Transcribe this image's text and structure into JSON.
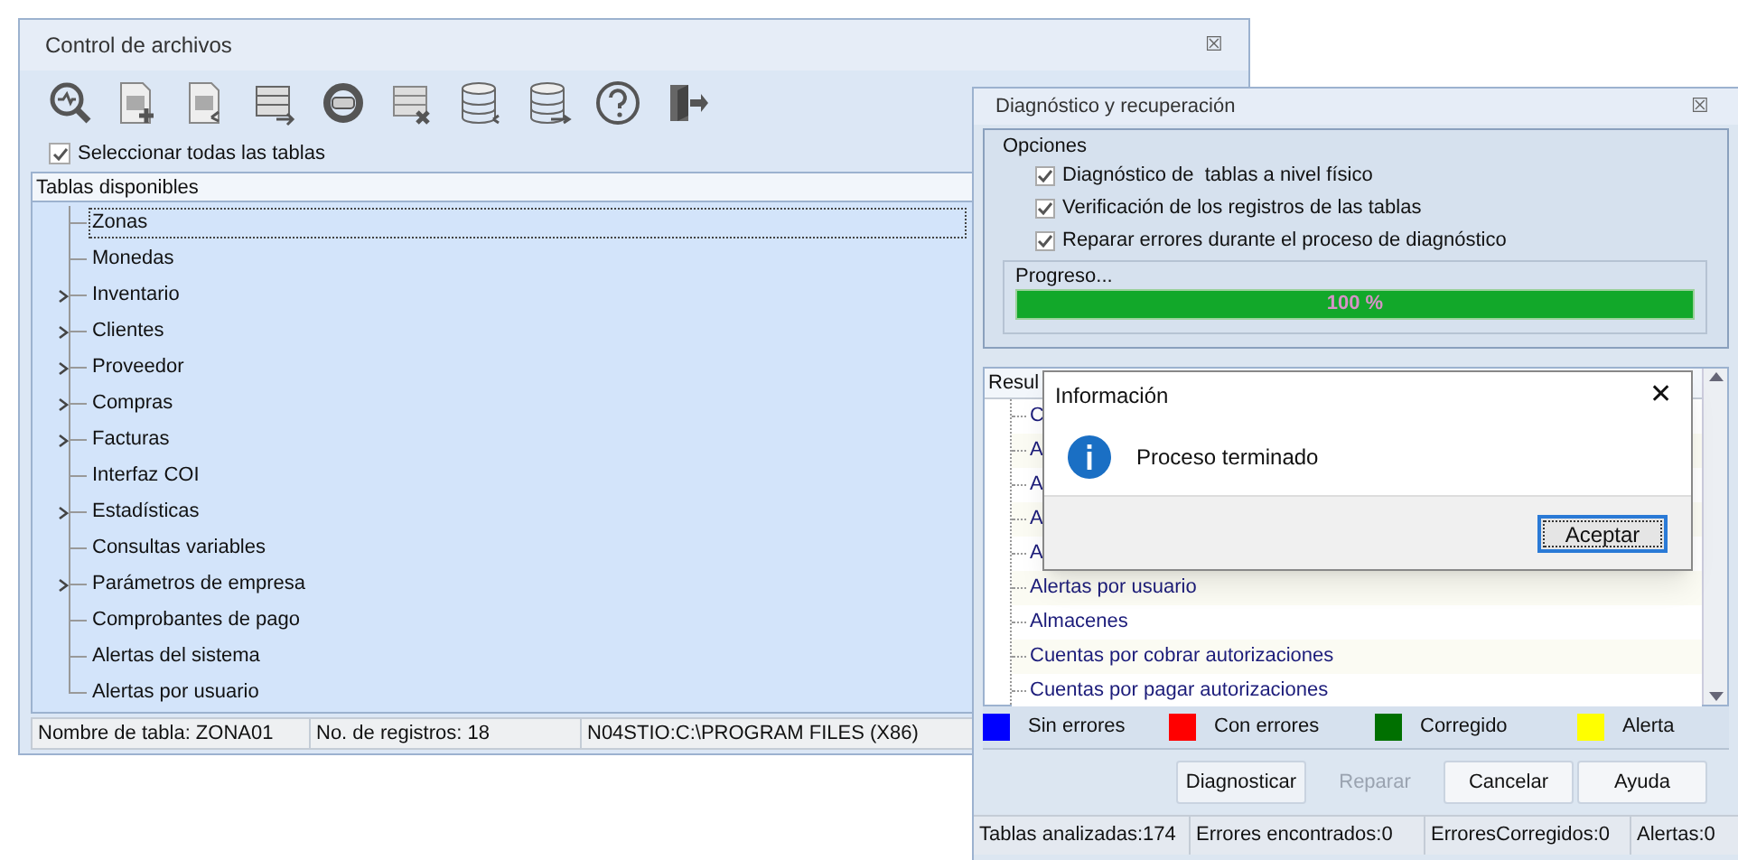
{
  "main_window": {
    "title": "Control de archivos",
    "close": "☒",
    "select_all": {
      "label": "Seleccionar todas las tablas",
      "checked": true
    },
    "tree": {
      "header": "Tablas disponibles",
      "items": [
        {
          "label": "Zonas",
          "expandable": false,
          "selected": true
        },
        {
          "label": "Monedas",
          "expandable": false,
          "selected": false
        },
        {
          "label": "Inventario",
          "expandable": true,
          "selected": false
        },
        {
          "label": "Clientes",
          "expandable": true,
          "selected": false
        },
        {
          "label": "Proveedor",
          "expandable": true,
          "selected": false
        },
        {
          "label": "Compras",
          "expandable": true,
          "selected": false
        },
        {
          "label": "Facturas",
          "expandable": true,
          "selected": false
        },
        {
          "label": "Interfaz COI",
          "expandable": false,
          "selected": false
        },
        {
          "label": "Estadísticas",
          "expandable": true,
          "selected": false
        },
        {
          "label": "Consultas variables",
          "expandable": false,
          "selected": false
        },
        {
          "label": "Parámetros de empresa",
          "expandable": true,
          "selected": false
        },
        {
          "label": "Comprobantes de pago",
          "expandable": false,
          "selected": false
        },
        {
          "label": "Alertas del sistema",
          "expandable": false,
          "selected": false
        },
        {
          "label": "Alertas por usuario",
          "expandable": false,
          "selected": false
        }
      ]
    },
    "status_bar": [
      "Nombre de tabla: ZONA01",
      "No. de registros: 18",
      "N04STIO:C:\\PROGRAM FILES (X86)"
    ]
  },
  "diagnostic_window": {
    "title": "Diagnóstico y recuperación",
    "close": "☒",
    "options": {
      "title": "Opciones",
      "items": [
        {
          "label": "Diagnóstico de  tablas a nivel físico",
          "checked": true
        },
        {
          "label": "Verificación de los registros de las tablas",
          "checked": true
        },
        {
          "label": "Reparar errores durante el proceso de diagnóstico",
          "checked": true
        }
      ]
    },
    "progress": {
      "label": "Progreso...",
      "level": 1,
      "reading": "100 %"
    },
    "results": {
      "header": "Resul",
      "rows": [
        "C",
        "A",
        "A",
        "A",
        "A",
        "Alertas por usuario",
        "Almacenes",
        "Cuentas por cobrar autorizaciones",
        "Cuentas por pagar autorizaciones"
      ]
    },
    "legend": [
      {
        "label": "Sin errores",
        "color": "#0000ff"
      },
      {
        "label": "Con errores",
        "color": "#ff0000"
      },
      {
        "label": "Corregido",
        "color": "#007000"
      },
      {
        "label": "Alerta",
        "color": "#ffff00"
      }
    ],
    "buttons": [
      {
        "label": "Diagnosticar",
        "disabled": false
      },
      {
        "label": "Reparar",
        "disabled": true
      },
      {
        "label": "Cancelar",
        "disabled": false
      },
      {
        "label": "Ayuda",
        "disabled": false
      }
    ],
    "status_bar": [
      "Tablas analizadas:174",
      "Errores encontrados:0",
      "ErroresCorregidos:0",
      "Alertas:0"
    ]
  },
  "dialog": {
    "title": "Información",
    "close": "✕",
    "message": "Proceso terminado",
    "button": "Aceptar"
  }
}
